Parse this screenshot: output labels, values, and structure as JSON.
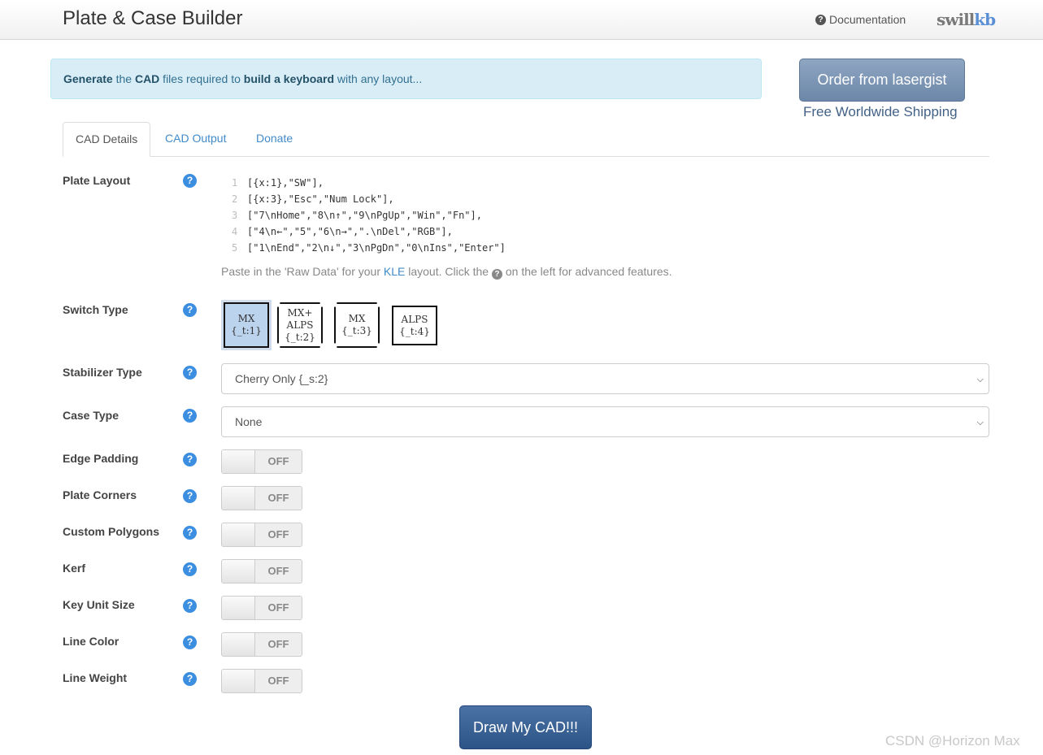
{
  "navbar": {
    "title": "Plate & Case Builder",
    "doc_icon": "question-circle-icon",
    "doc_label": "Documentation",
    "logo_part1": "swill",
    "logo_part2": "kb"
  },
  "alert": {
    "w1": "Generate",
    "w2": " the ",
    "w3": "CAD",
    "w4": " files required to ",
    "w5": "build a keyboard",
    "w6": " with any layout..."
  },
  "order": {
    "button_label": "Order from lasergist",
    "shipping": "Free Worldwide Shipping"
  },
  "tabs": [
    "CAD Details",
    "CAD Output",
    "Donate"
  ],
  "active_tab": "CAD Details",
  "plate_layout": {
    "label": "Plate Layout",
    "lines": [
      {
        "n": "1",
        "text": "[{x:1},\"SW\"],"
      },
      {
        "n": "2",
        "text": "[{x:3},\"Esc\",\"Num Lock\"],"
      },
      {
        "n": "3",
        "text": "[\"7\\nHome\",\"8\\n↑\",\"9\\nPgUp\",\"Win\",\"Fn\"],"
      },
      {
        "n": "4",
        "text": "[\"4\\n←\",\"5\",\"6\\n→\",\".\\nDel\",\"RGB\"],"
      },
      {
        "n": "5",
        "text": "[\"1\\nEnd\",\"2\\n↓\",\"3\\nPgDn\",\"0\\nIns\",\"Enter\"]"
      }
    ],
    "hint_pre": "Paste in the 'Raw Data' for your ",
    "hint_link": "KLE",
    "hint_mid": " layout. Click the ",
    "hint_post": " on the left for advanced features."
  },
  "switch_type": {
    "label": "Switch Type",
    "options": [
      {
        "l1": "MX",
        "l2": "",
        "l3": "{_t:1}",
        "selected": true
      },
      {
        "l1": "MX+",
        "l2": "ALPS",
        "l3": "{_t:2}",
        "selected": false
      },
      {
        "l1": "MX",
        "l2": "",
        "l3": "{_t:3}",
        "selected": false
      },
      {
        "l1": "ALPS",
        "l2": "",
        "l3": "{_t:4}",
        "selected": false
      }
    ]
  },
  "stabilizer": {
    "label": "Stabilizer Type",
    "value": "Cherry Only {_s:2}"
  },
  "case_type": {
    "label": "Case Type",
    "value": "None"
  },
  "toggles": [
    {
      "label": "Edge Padding",
      "state": "OFF"
    },
    {
      "label": "Plate Corners",
      "state": "OFF"
    },
    {
      "label": "Custom Polygons",
      "state": "OFF"
    },
    {
      "label": "Kerf",
      "state": "OFF"
    },
    {
      "label": "Key Unit Size",
      "state": "OFF"
    },
    {
      "label": "Line Color",
      "state": "OFF"
    },
    {
      "label": "Line Weight",
      "state": "OFF"
    }
  ],
  "draw_button": "Draw My CAD!!!",
  "watermark": "CSDN @Horizon Max",
  "colors": {
    "accent": "#428bca",
    "alert_bg": "#d9edf7",
    "draw_btn": "#2d5486",
    "order_btn": "#6c87a9"
  }
}
